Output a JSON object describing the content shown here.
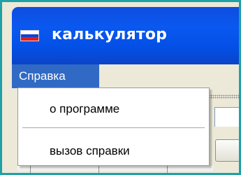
{
  "window": {
    "title": "калькулятор"
  },
  "menubar": {
    "items": [
      {
        "label": "Справка",
        "active": true
      }
    ]
  },
  "dropdown": {
    "items": [
      {
        "label": "о программе"
      },
      {
        "label": "вызов справки"
      }
    ]
  },
  "icons": {
    "app_icon": "russian-flag-icon"
  },
  "colors": {
    "title_bar": "#0a58f0",
    "menu_highlight": "#316ac5",
    "frame_border": "#1ea1a7",
    "flag_white": "#ffffff",
    "flag_blue": "#1a3fd0",
    "flag_red": "#e01e1e"
  }
}
